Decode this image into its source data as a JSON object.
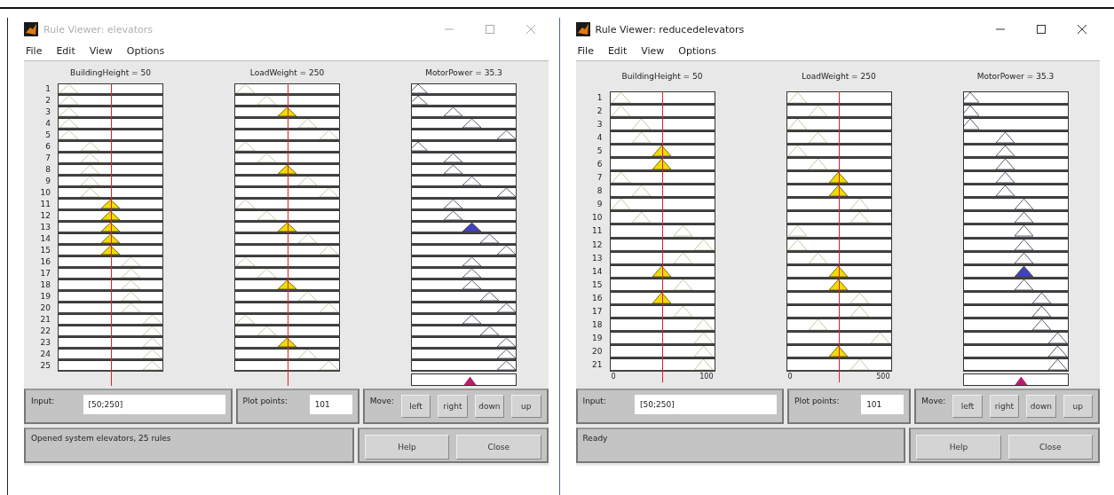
{
  "windows": [
    {
      "title": "Rule Viewer: elevators",
      "active": false,
      "menu": [
        "File",
        "Edit",
        "View",
        "Options"
      ],
      "columns": [
        {
          "header": "BuildingHeight = 50",
          "kind": "input",
          "level": 0.5
        },
        {
          "header": "LoadWeight = 250",
          "kind": "input",
          "level": 0.5
        },
        {
          "header": "MotorPower = 35.3",
          "kind": "output",
          "level": 0.56
        }
      ],
      "rows": [
        {
          "label": "1",
          "cells": [
            {
              "kind": "lowest",
              "fired": false
            },
            {
              "kind": "lowest",
              "fired": false
            },
            {
              "kind": "lowest",
              "fired": false
            }
          ]
        },
        {
          "label": "2",
          "cells": [
            {
              "kind": "lowest",
              "fired": false
            },
            {
              "kind": "low",
              "fired": false
            },
            {
              "kind": "lowest",
              "fired": false
            }
          ]
        },
        {
          "label": "3",
          "cells": [
            {
              "kind": "lowest",
              "fired": false
            },
            {
              "kind": "medium",
              "fired": true
            },
            {
              "kind": "low",
              "fired": false
            }
          ]
        },
        {
          "label": "4",
          "cells": [
            {
              "kind": "lowest",
              "fired": false
            },
            {
              "kind": "high",
              "fired": false
            },
            {
              "kind": "medium",
              "fired": false
            }
          ]
        },
        {
          "label": "5",
          "cells": [
            {
              "kind": "lowest",
              "fired": false
            },
            {
              "kind": "highest",
              "fired": false
            },
            {
              "kind": "highest",
              "fired": false
            }
          ]
        },
        {
          "label": "6",
          "cells": [
            {
              "kind": "low",
              "fired": false
            },
            {
              "kind": "lowest",
              "fired": false
            },
            {
              "kind": "lowest",
              "fired": false
            }
          ]
        },
        {
          "label": "7",
          "cells": [
            {
              "kind": "low",
              "fired": false
            },
            {
              "kind": "low",
              "fired": false
            },
            {
              "kind": "low",
              "fired": false
            }
          ]
        },
        {
          "label": "8",
          "cells": [
            {
              "kind": "low",
              "fired": false
            },
            {
              "kind": "medium",
              "fired": true
            },
            {
              "kind": "low",
              "fired": false
            }
          ]
        },
        {
          "label": "9",
          "cells": [
            {
              "kind": "low",
              "fired": false
            },
            {
              "kind": "high",
              "fired": false
            },
            {
              "kind": "medium",
              "fired": false
            }
          ]
        },
        {
          "label": "10",
          "cells": [
            {
              "kind": "low",
              "fired": false
            },
            {
              "kind": "highest",
              "fired": false
            },
            {
              "kind": "highest",
              "fired": false
            }
          ]
        },
        {
          "label": "11",
          "cells": [
            {
              "kind": "medium",
              "fired": true
            },
            {
              "kind": "lowest",
              "fired": false
            },
            {
              "kind": "low",
              "fired": false
            }
          ]
        },
        {
          "label": "12",
          "cells": [
            {
              "kind": "medium",
              "fired": true
            },
            {
              "kind": "low",
              "fired": false
            },
            {
              "kind": "low",
              "fired": false
            }
          ]
        },
        {
          "label": "13",
          "cells": [
            {
              "kind": "medium",
              "fired": true
            },
            {
              "kind": "medium",
              "fired": true
            },
            {
              "kind": "medium",
              "fired": true
            }
          ]
        },
        {
          "label": "14",
          "cells": [
            {
              "kind": "medium",
              "fired": true
            },
            {
              "kind": "high",
              "fired": false
            },
            {
              "kind": "high",
              "fired": false
            }
          ]
        },
        {
          "label": "15",
          "cells": [
            {
              "kind": "medium",
              "fired": true
            },
            {
              "kind": "highest",
              "fired": false
            },
            {
              "kind": "highest",
              "fired": false
            }
          ]
        },
        {
          "label": "16",
          "cells": [
            {
              "kind": "high",
              "fired": false
            },
            {
              "kind": "lowest",
              "fired": false
            },
            {
              "kind": "medium",
              "fired": false
            }
          ]
        },
        {
          "label": "17",
          "cells": [
            {
              "kind": "high",
              "fired": false
            },
            {
              "kind": "low",
              "fired": false
            },
            {
              "kind": "medium",
              "fired": false
            }
          ]
        },
        {
          "label": "18",
          "cells": [
            {
              "kind": "high",
              "fired": false
            },
            {
              "kind": "medium",
              "fired": true
            },
            {
              "kind": "medium",
              "fired": false
            }
          ]
        },
        {
          "label": "19",
          "cells": [
            {
              "kind": "high",
              "fired": false
            },
            {
              "kind": "high",
              "fired": false
            },
            {
              "kind": "high",
              "fired": false
            }
          ]
        },
        {
          "label": "20",
          "cells": [
            {
              "kind": "high",
              "fired": false
            },
            {
              "kind": "highest",
              "fired": false
            },
            {
              "kind": "highest",
              "fired": false
            }
          ]
        },
        {
          "label": "21",
          "cells": [
            {
              "kind": "highest",
              "fired": false
            },
            {
              "kind": "lowest",
              "fired": false
            },
            {
              "kind": "medium",
              "fired": false
            }
          ]
        },
        {
          "label": "22",
          "cells": [
            {
              "kind": "highest",
              "fired": false
            },
            {
              "kind": "low",
              "fired": false
            },
            {
              "kind": "high",
              "fired": false
            }
          ]
        },
        {
          "label": "23",
          "cells": [
            {
              "kind": "highest",
              "fired": false
            },
            {
              "kind": "medium",
              "fired": true
            },
            {
              "kind": "highest",
              "fired": false
            }
          ]
        },
        {
          "label": "24",
          "cells": [
            {
              "kind": "highest",
              "fired": false
            },
            {
              "kind": "high",
              "fired": false
            },
            {
              "kind": "highest",
              "fired": false
            }
          ]
        },
        {
          "label": "25",
          "cells": [
            {
              "kind": "highest",
              "fired": false
            },
            {
              "kind": "highest",
              "fired": false
            },
            {
              "kind": "highest",
              "fired": false
            }
          ]
        }
      ],
      "input": {
        "label": "Input:",
        "value": "[50;250]"
      },
      "plot_points": {
        "label": "Plot points:",
        "value": "101"
      },
      "move": {
        "label": "Move:",
        "buttons": [
          "left",
          "right",
          "down",
          "up"
        ]
      },
      "status": "Opened system elevators, 25 rules",
      "buttons": [
        "Help",
        "Close"
      ]
    },
    {
      "title": "Rule Viewer: reducedelevators",
      "active": true,
      "menu": [
        "File",
        "Edit",
        "View",
        "Options"
      ],
      "columns": [
        {
          "header": "BuildingHeight = 50",
          "kind": "input",
          "level": 0.5,
          "axis": [
            "0",
            "100"
          ]
        },
        {
          "header": "LoadWeight = 250",
          "kind": "input",
          "level": 0.5,
          "axis": [
            "0",
            "500"
          ]
        },
        {
          "header": "MotorPower = 35.3",
          "kind": "output",
          "level": 0.55
        }
      ],
      "rows": [
        {
          "label": "1",
          "cells": [
            {
              "kind": "lowest",
              "fired": false
            },
            {
              "kind": "lowest",
              "fired": false
            },
            {
              "kind": "lowest",
              "fired": false
            }
          ]
        },
        {
          "label": "2",
          "cells": [
            {
              "kind": "lowest",
              "fired": false
            },
            {
              "kind": "low",
              "fired": false
            },
            {
              "kind": "lowest",
              "fired": false
            }
          ]
        },
        {
          "label": "3",
          "cells": [
            {
              "kind": "low",
              "fired": false
            },
            {
              "kind": "lowest",
              "fired": false
            },
            {
              "kind": "lowest",
              "fired": false
            }
          ]
        },
        {
          "label": "4",
          "cells": [
            {
              "kind": "low",
              "fired": false
            },
            {
              "kind": "low",
              "fired": false
            },
            {
              "kind": "low",
              "fired": false
            }
          ]
        },
        {
          "label": "5",
          "cells": [
            {
              "kind": "medium",
              "fired": true
            },
            {
              "kind": "lowest",
              "fired": false
            },
            {
              "kind": "low",
              "fired": false
            }
          ]
        },
        {
          "label": "6",
          "cells": [
            {
              "kind": "medium",
              "fired": true
            },
            {
              "kind": "low",
              "fired": false
            },
            {
              "kind": "low",
              "fired": false
            }
          ]
        },
        {
          "label": "7",
          "cells": [
            {
              "kind": "lowest",
              "fired": false
            },
            {
              "kind": "medium",
              "fired": true
            },
            {
              "kind": "low",
              "fired": false
            }
          ]
        },
        {
          "label": "8",
          "cells": [
            {
              "kind": "low",
              "fired": false
            },
            {
              "kind": "medium",
              "fired": true
            },
            {
              "kind": "low",
              "fired": false
            }
          ]
        },
        {
          "label": "9",
          "cells": [
            {
              "kind": "lowest",
              "fired": false
            },
            {
              "kind": "high",
              "fired": false
            },
            {
              "kind": "medium",
              "fired": false
            }
          ]
        },
        {
          "label": "10",
          "cells": [
            {
              "kind": "low",
              "fired": false
            },
            {
              "kind": "high",
              "fired": false
            },
            {
              "kind": "medium",
              "fired": false
            }
          ]
        },
        {
          "label": "11",
          "cells": [
            {
              "kind": "high",
              "fired": false
            },
            {
              "kind": "lowest",
              "fired": false
            },
            {
              "kind": "medium",
              "fired": false
            }
          ]
        },
        {
          "label": "12",
          "cells": [
            {
              "kind": "highest",
              "fired": false
            },
            {
              "kind": "lowest",
              "fired": false
            },
            {
              "kind": "medium",
              "fired": false
            }
          ]
        },
        {
          "label": "13",
          "cells": [
            {
              "kind": "high",
              "fired": false
            },
            {
              "kind": "low",
              "fired": false
            },
            {
              "kind": "medium",
              "fired": false
            }
          ]
        },
        {
          "label": "14",
          "cells": [
            {
              "kind": "medium",
              "fired": true
            },
            {
              "kind": "medium",
              "fired": true
            },
            {
              "kind": "medium",
              "fired": true
            }
          ]
        },
        {
          "label": "15",
          "cells": [
            {
              "kind": "high",
              "fired": false
            },
            {
              "kind": "medium",
              "fired": true
            },
            {
              "kind": "medium",
              "fired": false
            }
          ]
        },
        {
          "label": "16",
          "cells": [
            {
              "kind": "medium",
              "fired": true
            },
            {
              "kind": "high",
              "fired": false
            },
            {
              "kind": "high",
              "fired": false
            }
          ]
        },
        {
          "label": "17",
          "cells": [
            {
              "kind": "high",
              "fired": false
            },
            {
              "kind": "high",
              "fired": false
            },
            {
              "kind": "high",
              "fired": false
            }
          ]
        },
        {
          "label": "18",
          "cells": [
            {
              "kind": "highest",
              "fired": false
            },
            {
              "kind": "low",
              "fired": false
            },
            {
              "kind": "high",
              "fired": false
            }
          ]
        },
        {
          "label": "19",
          "cells": [
            {
              "kind": "highest",
              "fired": false
            },
            {
              "kind": "highest",
              "fired": false
            },
            {
              "kind": "highest",
              "fired": false
            }
          ]
        },
        {
          "label": "20",
          "cells": [
            {
              "kind": "highest",
              "fired": false
            },
            {
              "kind": "medium",
              "fired": true
            },
            {
              "kind": "highest",
              "fired": false
            }
          ]
        },
        {
          "label": "21",
          "cells": [
            {
              "kind": "highest",
              "fired": false
            },
            {
              "kind": "high",
              "fired": false
            },
            {
              "kind": "highest",
              "fired": false
            }
          ]
        }
      ],
      "input": {
        "label": "Input:",
        "value": "[50;250]"
      },
      "plot_points": {
        "label": "Plot points:",
        "value": "101"
      },
      "move": {
        "label": "Move:",
        "buttons": [
          "left",
          "right",
          "down",
          "up"
        ]
      },
      "status": "Ready",
      "buttons": [
        "Help",
        "Close"
      ]
    }
  ]
}
